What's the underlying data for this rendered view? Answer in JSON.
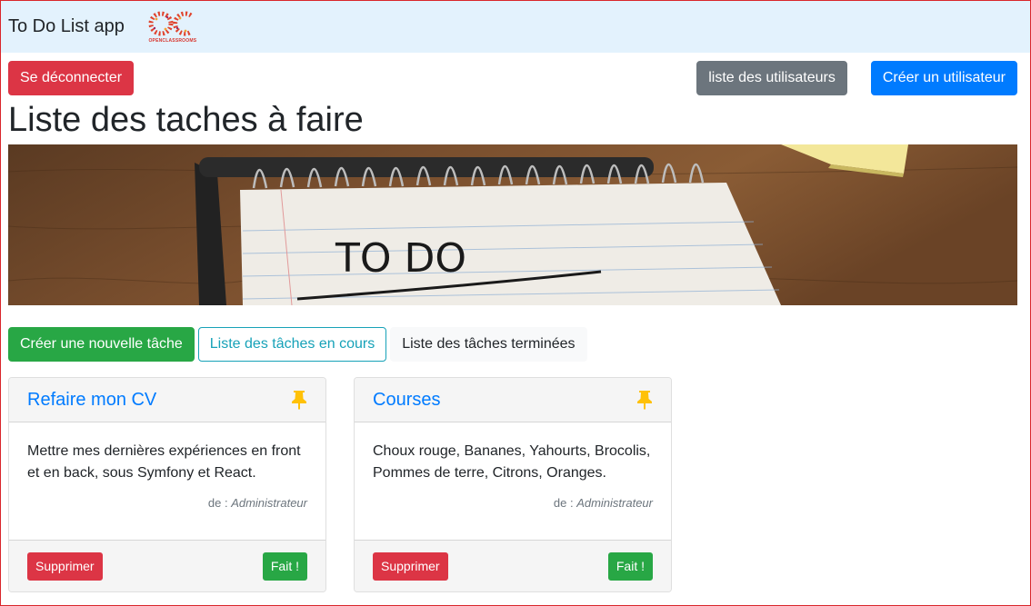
{
  "navbar": {
    "brand": "To Do List app",
    "logo_text": "OPENCLASSROOMS"
  },
  "top_actions": {
    "logout": "Se déconnecter",
    "users_list": "liste des utilisateurs",
    "create_user": "Créer un utilisateur"
  },
  "page_title": "Liste des taches à faire",
  "hero": {
    "handwritten": "TO DO"
  },
  "task_actions": {
    "create_task": "Créer une nouvelle tâche",
    "in_progress": "Liste des tâches en cours",
    "done": "Liste des tâches terminées"
  },
  "tasks": [
    {
      "title": "Refaire mon CV",
      "content": "Mettre mes dernières expériences en front et en back, sous Symfony et React.",
      "author_prefix": "de : ",
      "author": "Administrateur",
      "delete_label": "Supprimer",
      "done_label": "Fait !",
      "icon": "pin-icon"
    },
    {
      "title": "Courses",
      "content": "Choux rouge, Bananes, Yahourts, Brocolis, Pommes de terre, Citrons, Oranges.",
      "author_prefix": "de : ",
      "author": "Administrateur",
      "delete_label": "Supprimer",
      "done_label": "Fait !",
      "icon": "pin-icon"
    }
  ],
  "colors": {
    "navbar_bg": "#e3f2fd",
    "danger": "#dc3545",
    "secondary": "#6c757d",
    "primary": "#007bff",
    "success": "#28a745",
    "info": "#17a2b8",
    "pin": "#ffc107"
  }
}
